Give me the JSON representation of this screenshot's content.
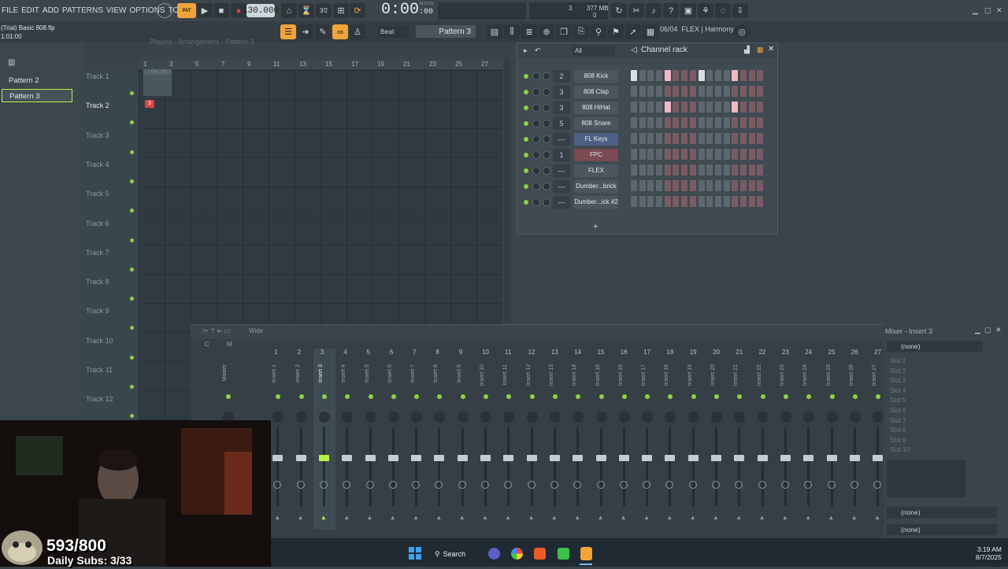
{
  "menu": [
    "FILE",
    "EDIT",
    "ADD",
    "PATTERNS",
    "VIEW",
    "OPTIONS",
    "TOOLS",
    "HELP"
  ],
  "transport": {
    "pat_label": "PAT",
    "bpm": "130.000",
    "timecode": "0:00",
    "timecode_frames": "00",
    "timecode_unit": "M:S:CS"
  },
  "cpu": {
    "voices": "3",
    "memory": "377 MB",
    "cpu_value": "0"
  },
  "project": {
    "title": "(Trial) Basic 808.flp",
    "position": "1:01:00"
  },
  "toolbar2": {
    "snap": "Beat",
    "pattern": "Pattern 3",
    "hint_counter": "06/04",
    "hint_text": "FLEX | Harmony"
  },
  "browser": {
    "patterns": [
      "Pattern 2",
      "Pattern 3"
    ]
  },
  "playlist": {
    "title": "Playlist - Arrangement › Pattern 3",
    "ruler": [
      "1",
      "3",
      "5",
      "7",
      "9",
      "11",
      "13",
      "15",
      "17",
      "19",
      "21",
      "23",
      "25",
      "27"
    ],
    "tracks": [
      "Track 1",
      "Track 2",
      "Track 3",
      "Track 4",
      "Track 5",
      "Track 6",
      "Track 7",
      "Track 8",
      "Track 9",
      "Track 10",
      "Track 11",
      "Track 12"
    ],
    "clip_label": "Da...ick",
    "pattern_clip": "3"
  },
  "channel_rack": {
    "title": "Channel rack",
    "filter": "All",
    "add": "+",
    "channels": [
      {
        "num": "2",
        "name": "808 Kick",
        "color": "#4b565e",
        "steps": [
          1,
          0,
          0,
          0,
          1,
          0,
          0,
          0,
          1,
          0,
          0,
          0,
          1,
          0,
          0,
          0
        ]
      },
      {
        "num": "3",
        "name": "808 Clap",
        "color": "#4b565e",
        "steps": [
          0,
          0,
          0,
          0,
          0,
          0,
          0,
          0,
          0,
          0,
          0,
          0,
          0,
          0,
          0,
          0
        ]
      },
      {
        "num": "3",
        "name": "808 HiHat",
        "color": "#4b565e",
        "steps": [
          0,
          0,
          0,
          0,
          1,
          0,
          0,
          0,
          0,
          0,
          0,
          0,
          1,
          0,
          0,
          0
        ]
      },
      {
        "num": "5",
        "name": "808 Snare",
        "color": "#4b565e",
        "steps": [
          0,
          0,
          0,
          0,
          0,
          0,
          0,
          0,
          0,
          0,
          0,
          0,
          0,
          0,
          0,
          0
        ]
      },
      {
        "num": "—",
        "name": "FL Keys",
        "color": "#4d5f82",
        "steps": [
          0,
          0,
          0,
          0,
          0,
          0,
          0,
          0,
          0,
          0,
          0,
          0,
          0,
          0,
          0,
          0
        ]
      },
      {
        "num": "1",
        "name": "FPC",
        "color": "#7b4a52",
        "steps": [
          0,
          0,
          0,
          0,
          0,
          0,
          0,
          0,
          0,
          0,
          0,
          0,
          0,
          0,
          0,
          0
        ]
      },
      {
        "num": "—",
        "name": "FLEX",
        "color": "#4b565e",
        "steps": [
          0,
          0,
          0,
          0,
          0,
          0,
          0,
          0,
          0,
          0,
          0,
          0,
          0,
          0,
          0,
          0
        ]
      },
      {
        "num": "—",
        "name": "Dumber...brick",
        "color": "#4b565e",
        "steps": [
          0,
          0,
          0,
          0,
          0,
          0,
          0,
          0,
          0,
          0,
          0,
          0,
          0,
          0,
          0,
          0
        ]
      },
      {
        "num": "—",
        "name": "Dumber...ick #2",
        "color": "#4b565e",
        "steps": [
          0,
          0,
          0,
          0,
          0,
          0,
          0,
          0,
          0,
          0,
          0,
          0,
          0,
          0,
          0,
          0
        ]
      }
    ]
  },
  "mixer": {
    "view": "Wide",
    "master_letters": [
      "C",
      "M"
    ],
    "strips": [
      "Master",
      "Insert 1",
      "Insert 2",
      "Insert 3",
      "Insert 4",
      "Insert 5",
      "Insert 6",
      "Insert 7",
      "Insert 8",
      "Insert 9",
      "Insert 10",
      "Insert 11",
      "Insert 12",
      "Insert 13",
      "Insert 14",
      "Insert 15",
      "Insert 16",
      "Insert 17",
      "Insert 18",
      "Insert 19",
      "Insert 20",
      "Insert 21",
      "Insert 22",
      "Insert 23",
      "Insert 24",
      "Insert 25",
      "Insert 26",
      "Insert 27",
      "Insert 28"
    ],
    "numbers": [
      "",
      "1",
      "2",
      "3",
      "4",
      "5",
      "6",
      "7",
      "8",
      "9",
      "10",
      "11",
      "12",
      "13",
      "14",
      "15",
      "16",
      "17",
      "18",
      "19",
      "20",
      "21",
      "22",
      "23",
      "24",
      "25",
      "26",
      "27",
      "28"
    ],
    "selected": 3
  },
  "insert_panel": {
    "title": "Mixer - Insert 3",
    "input": "(none)",
    "slots": [
      "Slot 1",
      "Slot 2",
      "Slot 3",
      "Slot 4",
      "Slot 5",
      "Slot 6",
      "Slot 7",
      "Slot 8",
      "Slot 9",
      "Slot 10"
    ],
    "output_top": "(none)",
    "output_bottom": "(none)"
  },
  "overlay": {
    "counter": "593/800",
    "daily_subs": "Daily Subs: 3/33"
  },
  "taskbar": {
    "search": "Search",
    "time": "3:19 AM",
    "date": "8/7/2025"
  },
  "colors": {
    "accent_orange": "#f0a43a",
    "led_green": "#8dd33f",
    "step_pink": "#f1b8c4",
    "selected_green": "#b7f04a",
    "record_red": "#e0443e"
  }
}
